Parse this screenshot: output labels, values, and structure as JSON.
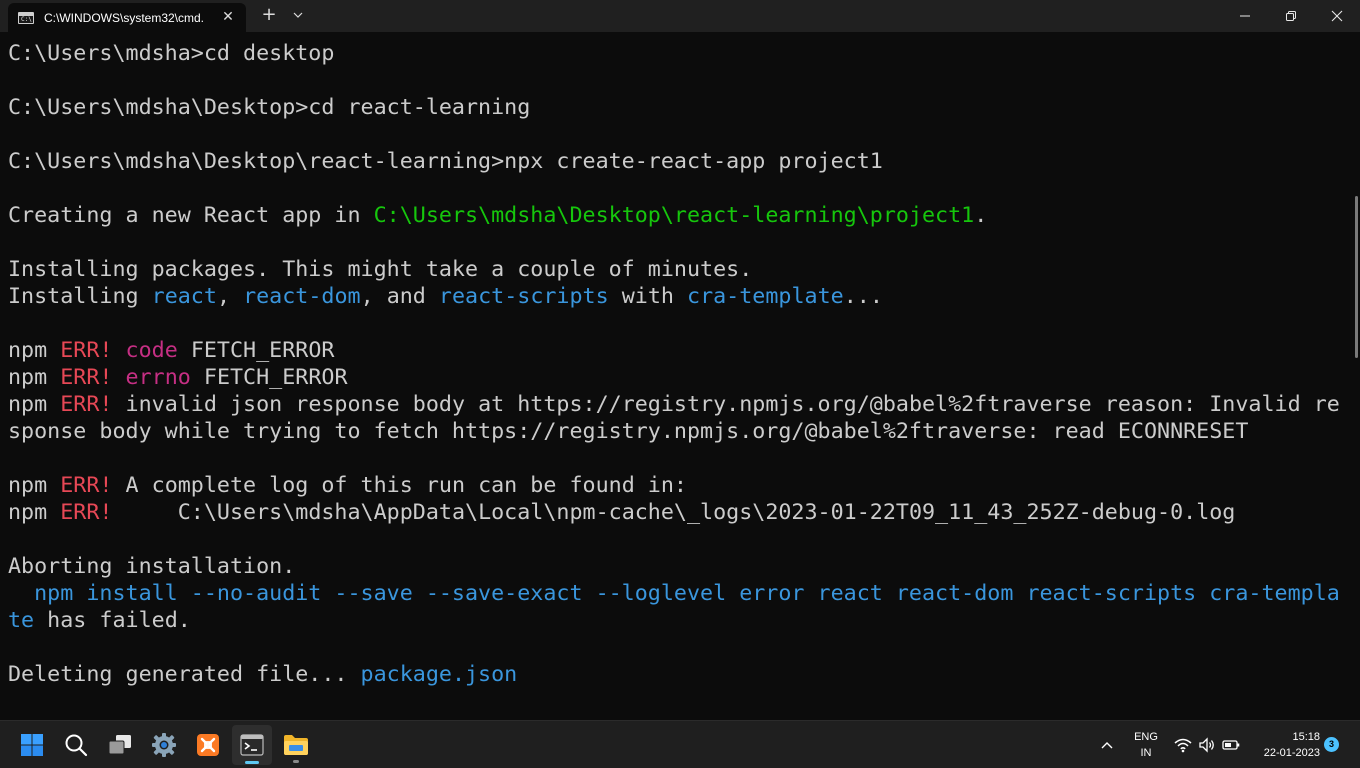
{
  "window": {
    "tab_title": "C:\\WINDOWS\\system32\\cmd.",
    "tab_icon_text": "C:\\",
    "tab_close": "✕",
    "new_tab": "+",
    "tab_dropdown": "⌵"
  },
  "terminal": {
    "lines": [
      [
        {
          "t": "C:\\Users\\mdsha>cd desktop",
          "c": "white"
        }
      ],
      [],
      [
        {
          "t": "C:\\Users\\mdsha\\Desktop>cd react-learning",
          "c": "white"
        }
      ],
      [],
      [
        {
          "t": "C:\\Users\\mdsha\\Desktop\\react-learning>npx create-react-app project1",
          "c": "white"
        }
      ],
      [],
      [
        {
          "t": "Creating a new React app in ",
          "c": "white"
        },
        {
          "t": "C:\\Users\\mdsha\\Desktop\\react-learning\\project1",
          "c": "green"
        },
        {
          "t": ".",
          "c": "white"
        }
      ],
      [],
      [
        {
          "t": "Installing packages. This might take a couple of minutes.",
          "c": "white"
        }
      ],
      [
        {
          "t": "Installing ",
          "c": "white"
        },
        {
          "t": "react",
          "c": "blue"
        },
        {
          "t": ", ",
          "c": "white"
        },
        {
          "t": "react-dom",
          "c": "blue"
        },
        {
          "t": ", and ",
          "c": "white"
        },
        {
          "t": "react-scripts",
          "c": "blue"
        },
        {
          "t": " with ",
          "c": "white"
        },
        {
          "t": "cra-template",
          "c": "blue"
        },
        {
          "t": "...",
          "c": "white"
        }
      ],
      [],
      [
        {
          "t": "npm ",
          "c": "white"
        },
        {
          "t": "ERR!",
          "c": "red"
        },
        {
          "t": " ",
          "c": "white"
        },
        {
          "t": "code",
          "c": "magenta"
        },
        {
          "t": " FETCH_ERROR",
          "c": "white"
        }
      ],
      [
        {
          "t": "npm ",
          "c": "white"
        },
        {
          "t": "ERR!",
          "c": "red"
        },
        {
          "t": " ",
          "c": "white"
        },
        {
          "t": "errno",
          "c": "magenta"
        },
        {
          "t": " FETCH_ERROR",
          "c": "white"
        }
      ],
      [
        {
          "t": "npm ",
          "c": "white"
        },
        {
          "t": "ERR!",
          "c": "red"
        },
        {
          "t": " invalid json response body at https://registry.npmjs.org/@babel%2ftraverse reason: Invalid re",
          "c": "white"
        }
      ],
      [
        {
          "t": "sponse body while trying to fetch https://registry.npmjs.org/@babel%2ftraverse: read ECONNRESET",
          "c": "white"
        }
      ],
      [],
      [
        {
          "t": "npm ",
          "c": "white"
        },
        {
          "t": "ERR!",
          "c": "red"
        },
        {
          "t": " A complete log of this run can be found in:",
          "c": "white"
        }
      ],
      [
        {
          "t": "npm ",
          "c": "white"
        },
        {
          "t": "ERR!",
          "c": "red"
        },
        {
          "t": "     C:\\Users\\mdsha\\AppData\\Local\\npm-cache\\_logs\\2023-01-22T09_11_43_252Z-debug-0.log",
          "c": "white"
        }
      ],
      [],
      [
        {
          "t": "Aborting installation.",
          "c": "white"
        }
      ],
      [
        {
          "t": "  npm install --no-audit --save --save-exact --loglevel error react react-dom react-scripts cra-templa",
          "c": "blue"
        }
      ],
      [
        {
          "t": "te",
          "c": "blue"
        },
        {
          "t": " has failed.",
          "c": "white"
        }
      ],
      [],
      [
        {
          "t": "Deleting generated file... ",
          "c": "white"
        },
        {
          "t": "package.json",
          "c": "blue"
        }
      ]
    ]
  },
  "taskbar": {
    "apps": [
      {
        "name": "start-button",
        "icon": "windows-logo-icon"
      },
      {
        "name": "search-button",
        "icon": "search-icon"
      },
      {
        "name": "task-view-button",
        "icon": "task-view-icon"
      },
      {
        "name": "settings-app",
        "icon": "gear-icon"
      },
      {
        "name": "xampp-app",
        "icon": "xampp-icon"
      },
      {
        "name": "terminal-app",
        "icon": "terminal-icon"
      },
      {
        "name": "file-explorer-app",
        "icon": "folder-icon"
      }
    ],
    "lang_top": "ENG",
    "lang_bottom": "IN",
    "time": "15:18",
    "date": "22-01-2023",
    "notification_count": "3",
    "chevron": "⌃"
  },
  "colors": {
    "white": "#cccccc",
    "green": "#16c60c",
    "blue": "#3a96dd",
    "red": "#e74856",
    "magenta": "#c62f84"
  }
}
